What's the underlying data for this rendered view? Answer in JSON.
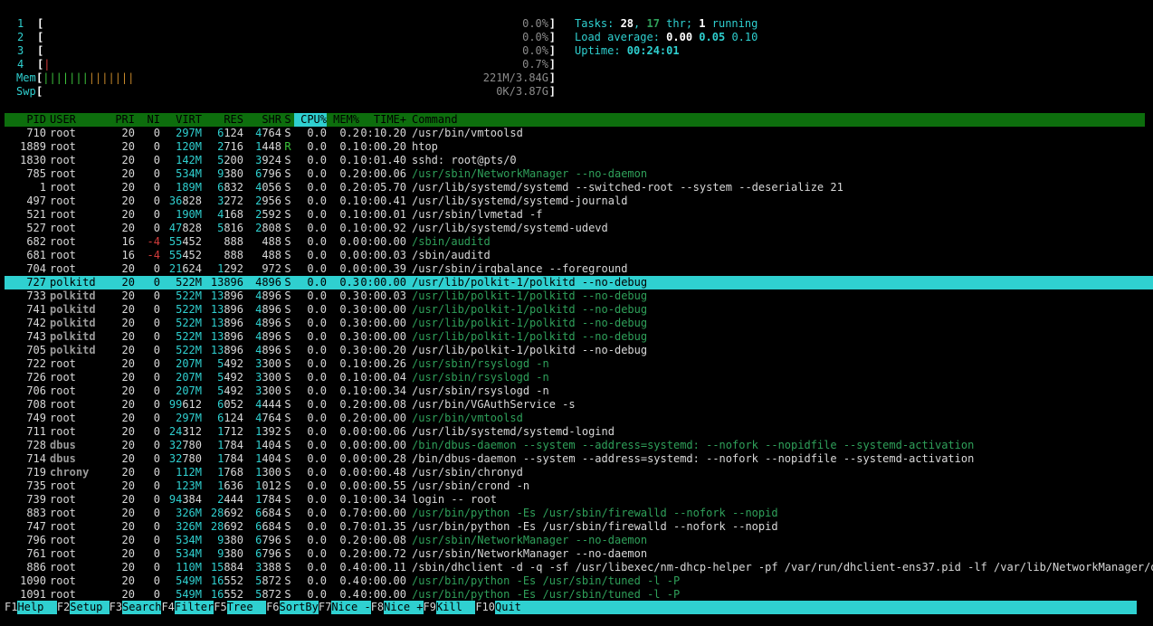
{
  "meters": {
    "cpus": [
      {
        "label": "1",
        "bar": "",
        "bar_color": "#d23c3c",
        "value": "0.0%"
      },
      {
        "label": "2",
        "bar": "",
        "bar_color": "#d23c3c",
        "value": "0.0%"
      },
      {
        "label": "3",
        "bar": "",
        "bar_color": "#d23c3c",
        "value": "0.0%"
      },
      {
        "label": "4",
        "bar": "|",
        "bar_color": "#d23c3c",
        "value": "0.7%"
      }
    ],
    "mem": {
      "label": "Mem",
      "bar": "||||||||||||||",
      "value": "221M/3.84G"
    },
    "swp": {
      "label": "Swp",
      "bar": "",
      "value": "0K/3.87G"
    }
  },
  "summary": {
    "tasks_label": "Tasks: ",
    "tasks": "28",
    "sep": ", ",
    "thr": "17",
    "thr_label": " thr; ",
    "running": "1",
    "running_label": " running",
    "load_label": "Load average: ",
    "load1": "0.00",
    "load5": "0.05",
    "load15": "0.10",
    "uptime_label": "Uptime: ",
    "uptime": "00:24:01"
  },
  "columns": {
    "pid": "PID",
    "user": "USER",
    "pri": "PRI",
    "ni": "NI",
    "virt": "VIRT",
    "res": "RES",
    "shr": "SHR",
    "s": "S",
    "cpu": "CPU%",
    "mem": "MEM%",
    "time": "TIME+",
    "cmd": "Command"
  },
  "processes": [
    {
      "pid": "710",
      "user": "root",
      "pri": "20",
      "ni": "0",
      "virt": "297M",
      "res": "6124",
      "shr": "4764",
      "s": "S",
      "cpu": "0.0",
      "mem": "0.2",
      "time": "0:10.20",
      "cmd": "/usr/bin/vmtoolsd",
      "thread": false
    },
    {
      "pid": "1889",
      "user": "root",
      "pri": "20",
      "ni": "0",
      "virt": "120M",
      "res": "2716",
      "shr": "1448",
      "s": "R",
      "cpu": "0.0",
      "mem": "0.1",
      "time": "0:00.20",
      "cmd": "htop",
      "thread": false
    },
    {
      "pid": "1830",
      "user": "root",
      "pri": "20",
      "ni": "0",
      "virt": "142M",
      "res": "5200",
      "shr": "3924",
      "s": "S",
      "cpu": "0.0",
      "mem": "0.1",
      "time": "0:01.40",
      "cmd": "sshd: root@pts/0",
      "thread": false
    },
    {
      "pid": "785",
      "user": "root",
      "pri": "20",
      "ni": "0",
      "virt": "534M",
      "res": "9380",
      "shr": "6796",
      "s": "S",
      "cpu": "0.0",
      "mem": "0.2",
      "time": "0:00.06",
      "cmd": "/usr/sbin/NetworkManager --no-daemon",
      "thread": true
    },
    {
      "pid": "1",
      "user": "root",
      "pri": "20",
      "ni": "0",
      "virt": "189M",
      "res": "6832",
      "shr": "4056",
      "s": "S",
      "cpu": "0.0",
      "mem": "0.2",
      "time": "0:05.70",
      "cmd": "/usr/lib/systemd/systemd --switched-root --system --deserialize 21",
      "thread": false
    },
    {
      "pid": "497",
      "user": "root",
      "pri": "20",
      "ni": "0",
      "virt": "36828",
      "res": "3272",
      "shr": "2956",
      "s": "S",
      "cpu": "0.0",
      "mem": "0.1",
      "time": "0:00.41",
      "cmd": "/usr/lib/systemd/systemd-journald",
      "thread": false
    },
    {
      "pid": "521",
      "user": "root",
      "pri": "20",
      "ni": "0",
      "virt": "190M",
      "res": "4168",
      "shr": "2592",
      "s": "S",
      "cpu": "0.0",
      "mem": "0.1",
      "time": "0:00.01",
      "cmd": "/usr/sbin/lvmetad -f",
      "thread": false
    },
    {
      "pid": "527",
      "user": "root",
      "pri": "20",
      "ni": "0",
      "virt": "47828",
      "res": "5816",
      "shr": "2808",
      "s": "S",
      "cpu": "0.0",
      "mem": "0.1",
      "time": "0:00.92",
      "cmd": "/usr/lib/systemd/systemd-udevd",
      "thread": false
    },
    {
      "pid": "682",
      "user": "root",
      "pri": "16",
      "ni": "-4",
      "virt": "55452",
      "res": "888",
      "shr": "488",
      "s": "S",
      "cpu": "0.0",
      "mem": "0.0",
      "time": "0:00.00",
      "cmd": "/sbin/auditd",
      "thread": true
    },
    {
      "pid": "681",
      "user": "root",
      "pri": "16",
      "ni": "-4",
      "virt": "55452",
      "res": "888",
      "shr": "488",
      "s": "S",
      "cpu": "0.0",
      "mem": "0.0",
      "time": "0:00.03",
      "cmd": "/sbin/auditd",
      "thread": false
    },
    {
      "pid": "704",
      "user": "root",
      "pri": "20",
      "ni": "0",
      "virt": "21624",
      "res": "1292",
      "shr": "972",
      "s": "S",
      "cpu": "0.0",
      "mem": "0.0",
      "time": "0:00.39",
      "cmd": "/usr/sbin/irqbalance --foreground",
      "thread": false
    },
    {
      "pid": "727",
      "user": "polkitd",
      "pri": "20",
      "ni": "0",
      "virt": "522M",
      "res": "13896",
      "shr": "4896",
      "s": "S",
      "cpu": "0.0",
      "mem": "0.3",
      "time": "0:00.00",
      "cmd": "/usr/lib/polkit-1/polkitd --no-debug",
      "thread": true,
      "selected": true
    },
    {
      "pid": "733",
      "user": "polkitd",
      "pri": "20",
      "ni": "0",
      "virt": "522M",
      "res": "13896",
      "shr": "4896",
      "s": "S",
      "cpu": "0.0",
      "mem": "0.3",
      "time": "0:00.03",
      "cmd": "/usr/lib/polkit-1/polkitd --no-debug",
      "thread": true
    },
    {
      "pid": "741",
      "user": "polkitd",
      "pri": "20",
      "ni": "0",
      "virt": "522M",
      "res": "13896",
      "shr": "4896",
      "s": "S",
      "cpu": "0.0",
      "mem": "0.3",
      "time": "0:00.00",
      "cmd": "/usr/lib/polkit-1/polkitd --no-debug",
      "thread": true
    },
    {
      "pid": "742",
      "user": "polkitd",
      "pri": "20",
      "ni": "0",
      "virt": "522M",
      "res": "13896",
      "shr": "4896",
      "s": "S",
      "cpu": "0.0",
      "mem": "0.3",
      "time": "0:00.00",
      "cmd": "/usr/lib/polkit-1/polkitd --no-debug",
      "thread": true
    },
    {
      "pid": "743",
      "user": "polkitd",
      "pri": "20",
      "ni": "0",
      "virt": "522M",
      "res": "13896",
      "shr": "4896",
      "s": "S",
      "cpu": "0.0",
      "mem": "0.3",
      "time": "0:00.00",
      "cmd": "/usr/lib/polkit-1/polkitd --no-debug",
      "thread": true
    },
    {
      "pid": "705",
      "user": "polkitd",
      "pri": "20",
      "ni": "0",
      "virt": "522M",
      "res": "13896",
      "shr": "4896",
      "s": "S",
      "cpu": "0.0",
      "mem": "0.3",
      "time": "0:00.20",
      "cmd": "/usr/lib/polkit-1/polkitd --no-debug",
      "thread": false
    },
    {
      "pid": "722",
      "user": "root",
      "pri": "20",
      "ni": "0",
      "virt": "207M",
      "res": "5492",
      "shr": "3300",
      "s": "S",
      "cpu": "0.0",
      "mem": "0.1",
      "time": "0:00.26",
      "cmd": "/usr/sbin/rsyslogd -n",
      "thread": true
    },
    {
      "pid": "726",
      "user": "root",
      "pri": "20",
      "ni": "0",
      "virt": "207M",
      "res": "5492",
      "shr": "3300",
      "s": "S",
      "cpu": "0.0",
      "mem": "0.1",
      "time": "0:00.04",
      "cmd": "/usr/sbin/rsyslogd -n",
      "thread": true
    },
    {
      "pid": "706",
      "user": "root",
      "pri": "20",
      "ni": "0",
      "virt": "207M",
      "res": "5492",
      "shr": "3300",
      "s": "S",
      "cpu": "0.0",
      "mem": "0.1",
      "time": "0:00.34",
      "cmd": "/usr/sbin/rsyslogd -n",
      "thread": false
    },
    {
      "pid": "708",
      "user": "root",
      "pri": "20",
      "ni": "0",
      "virt": "99612",
      "res": "6052",
      "shr": "4444",
      "s": "S",
      "cpu": "0.0",
      "mem": "0.2",
      "time": "0:00.08",
      "cmd": "/usr/bin/VGAuthService -s",
      "thread": false
    },
    {
      "pid": "749",
      "user": "root",
      "pri": "20",
      "ni": "0",
      "virt": "297M",
      "res": "6124",
      "shr": "4764",
      "s": "S",
      "cpu": "0.0",
      "mem": "0.2",
      "time": "0:00.00",
      "cmd": "/usr/bin/vmtoolsd",
      "thread": true
    },
    {
      "pid": "711",
      "user": "root",
      "pri": "20",
      "ni": "0",
      "virt": "24312",
      "res": "1712",
      "shr": "1392",
      "s": "S",
      "cpu": "0.0",
      "mem": "0.0",
      "time": "0:00.06",
      "cmd": "/usr/lib/systemd/systemd-logind",
      "thread": false
    },
    {
      "pid": "728",
      "user": "dbus",
      "pri": "20",
      "ni": "0",
      "virt": "32780",
      "res": "1784",
      "shr": "1404",
      "s": "S",
      "cpu": "0.0",
      "mem": "0.0",
      "time": "0:00.00",
      "cmd": "/bin/dbus-daemon --system --address=systemd: --nofork --nopidfile --systemd-activation",
      "thread": true
    },
    {
      "pid": "714",
      "user": "dbus",
      "pri": "20",
      "ni": "0",
      "virt": "32780",
      "res": "1784",
      "shr": "1404",
      "s": "S",
      "cpu": "0.0",
      "mem": "0.0",
      "time": "0:00.28",
      "cmd": "/bin/dbus-daemon --system --address=systemd: --nofork --nopidfile --systemd-activation",
      "thread": false
    },
    {
      "pid": "719",
      "user": "chrony",
      "pri": "20",
      "ni": "0",
      "virt": "112M",
      "res": "1768",
      "shr": "1300",
      "s": "S",
      "cpu": "0.0",
      "mem": "0.0",
      "time": "0:00.48",
      "cmd": "/usr/sbin/chronyd",
      "thread": false
    },
    {
      "pid": "735",
      "user": "root",
      "pri": "20",
      "ni": "0",
      "virt": "123M",
      "res": "1636",
      "shr": "1012",
      "s": "S",
      "cpu": "0.0",
      "mem": "0.0",
      "time": "0:00.55",
      "cmd": "/usr/sbin/crond -n",
      "thread": false
    },
    {
      "pid": "739",
      "user": "root",
      "pri": "20",
      "ni": "0",
      "virt": "94384",
      "res": "2444",
      "shr": "1784",
      "s": "S",
      "cpu": "0.0",
      "mem": "0.1",
      "time": "0:00.34",
      "cmd": "login -- root",
      "thread": false
    },
    {
      "pid": "883",
      "user": "root",
      "pri": "20",
      "ni": "0",
      "virt": "326M",
      "res": "28692",
      "shr": "6684",
      "s": "S",
      "cpu": "0.0",
      "mem": "0.7",
      "time": "0:00.00",
      "cmd": "/usr/bin/python -Es /usr/sbin/firewalld --nofork --nopid",
      "thread": true
    },
    {
      "pid": "747",
      "user": "root",
      "pri": "20",
      "ni": "0",
      "virt": "326M",
      "res": "28692",
      "shr": "6684",
      "s": "S",
      "cpu": "0.0",
      "mem": "0.7",
      "time": "0:01.35",
      "cmd": "/usr/bin/python -Es /usr/sbin/firewalld --nofork --nopid",
      "thread": false
    },
    {
      "pid": "796",
      "user": "root",
      "pri": "20",
      "ni": "0",
      "virt": "534M",
      "res": "9380",
      "shr": "6796",
      "s": "S",
      "cpu": "0.0",
      "mem": "0.2",
      "time": "0:00.08",
      "cmd": "/usr/sbin/NetworkManager --no-daemon",
      "thread": true
    },
    {
      "pid": "761",
      "user": "root",
      "pri": "20",
      "ni": "0",
      "virt": "534M",
      "res": "9380",
      "shr": "6796",
      "s": "S",
      "cpu": "0.0",
      "mem": "0.2",
      "time": "0:00.72",
      "cmd": "/usr/sbin/NetworkManager --no-daemon",
      "thread": false
    },
    {
      "pid": "886",
      "user": "root",
      "pri": "20",
      "ni": "0",
      "virt": "110M",
      "res": "15884",
      "shr": "3388",
      "s": "S",
      "cpu": "0.0",
      "mem": "0.4",
      "time": "0:00.11",
      "cmd": "/sbin/dhclient -d -q -sf /usr/libexec/nm-dhcp-helper -pf /var/run/dhclient-ens37.pid -lf /var/lib/NetworkManager/dhc",
      "thread": false
    },
    {
      "pid": "1090",
      "user": "root",
      "pri": "20",
      "ni": "0",
      "virt": "549M",
      "res": "16552",
      "shr": "5872",
      "s": "S",
      "cpu": "0.0",
      "mem": "0.4",
      "time": "0:00.00",
      "cmd": "/usr/bin/python -Es /usr/sbin/tuned -l -P",
      "thread": true
    },
    {
      "pid": "1091",
      "user": "root",
      "pri": "20",
      "ni": "0",
      "virt": "549M",
      "res": "16552",
      "shr": "5872",
      "s": "S",
      "cpu": "0.0",
      "mem": "0.4",
      "time": "0:00.00",
      "cmd": "/usr/bin/python -Es /usr/sbin/tuned -l -P",
      "thread": true
    }
  ],
  "footer": [
    {
      "key": "F1",
      "label": "Help  "
    },
    {
      "key": "F2",
      "label": "Setup "
    },
    {
      "key": "F3",
      "label": "Search"
    },
    {
      "key": "F4",
      "label": "Filter"
    },
    {
      "key": "F5",
      "label": "Tree  "
    },
    {
      "key": "F6",
      "label": "SortBy"
    },
    {
      "key": "F7",
      "label": "Nice -"
    },
    {
      "key": "F8",
      "label": "Nice +"
    },
    {
      "key": "F9",
      "label": "Kill  "
    },
    {
      "key": "F10",
      "label": "Quit"
    }
  ],
  "colors": {
    "header_bg": "#0d6e0d",
    "selected_bg": "#2fd0d0",
    "accent": "#2fd0d0",
    "thread_text": "#2fa05a"
  }
}
